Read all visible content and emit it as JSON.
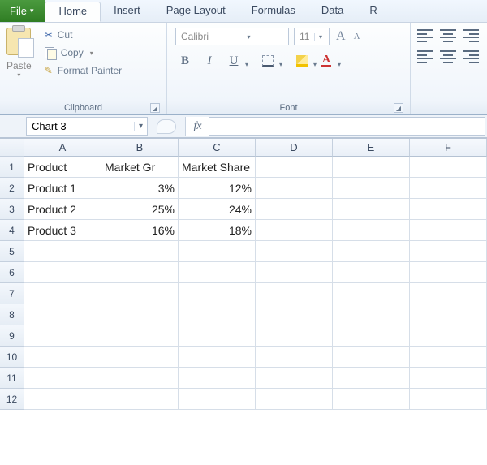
{
  "tabs": {
    "file": "File",
    "home": "Home",
    "insert": "Insert",
    "page_layout": "Page Layout",
    "formulas": "Formulas",
    "data": "Data",
    "review_partial": "R"
  },
  "ribbon": {
    "clipboard": {
      "paste": "Paste",
      "cut": "Cut",
      "copy": "Copy",
      "format_painter": "Format Painter",
      "group_label": "Clipboard"
    },
    "font": {
      "font_name": "Calibri",
      "font_size": "11",
      "bold": "B",
      "italic": "I",
      "underline": "U",
      "fontcolor_glyph": "A",
      "grow": "A",
      "shrink": "A",
      "group_label": "Font"
    }
  },
  "name_box": "Chart 3",
  "fx_label": "fx",
  "formula_value": "",
  "columns": [
    "A",
    "B",
    "C",
    "D",
    "E",
    "F"
  ],
  "row_count": 12,
  "cells": {
    "A1": "Product",
    "B1": "Market Gr",
    "B1_full": "Market Growth",
    "C1": "Market Share",
    "A2": "Product 1",
    "B2": "3%",
    "C2": "12%",
    "A3": "Product 2",
    "B3": "25%",
    "C3": "24%",
    "A4": "Product 3",
    "B4": "16%",
    "C4": "18%"
  },
  "chart_data": {
    "type": "table",
    "title": "",
    "columns": [
      "Product",
      "Market Growth",
      "Market Share"
    ],
    "rows": [
      {
        "Product": "Product 1",
        "Market Growth": 0.03,
        "Market Share": 0.12
      },
      {
        "Product": "Product 2",
        "Market Growth": 0.25,
        "Market Share": 0.24
      },
      {
        "Product": "Product 3",
        "Market Growth": 0.16,
        "Market Share": 0.18
      }
    ]
  }
}
